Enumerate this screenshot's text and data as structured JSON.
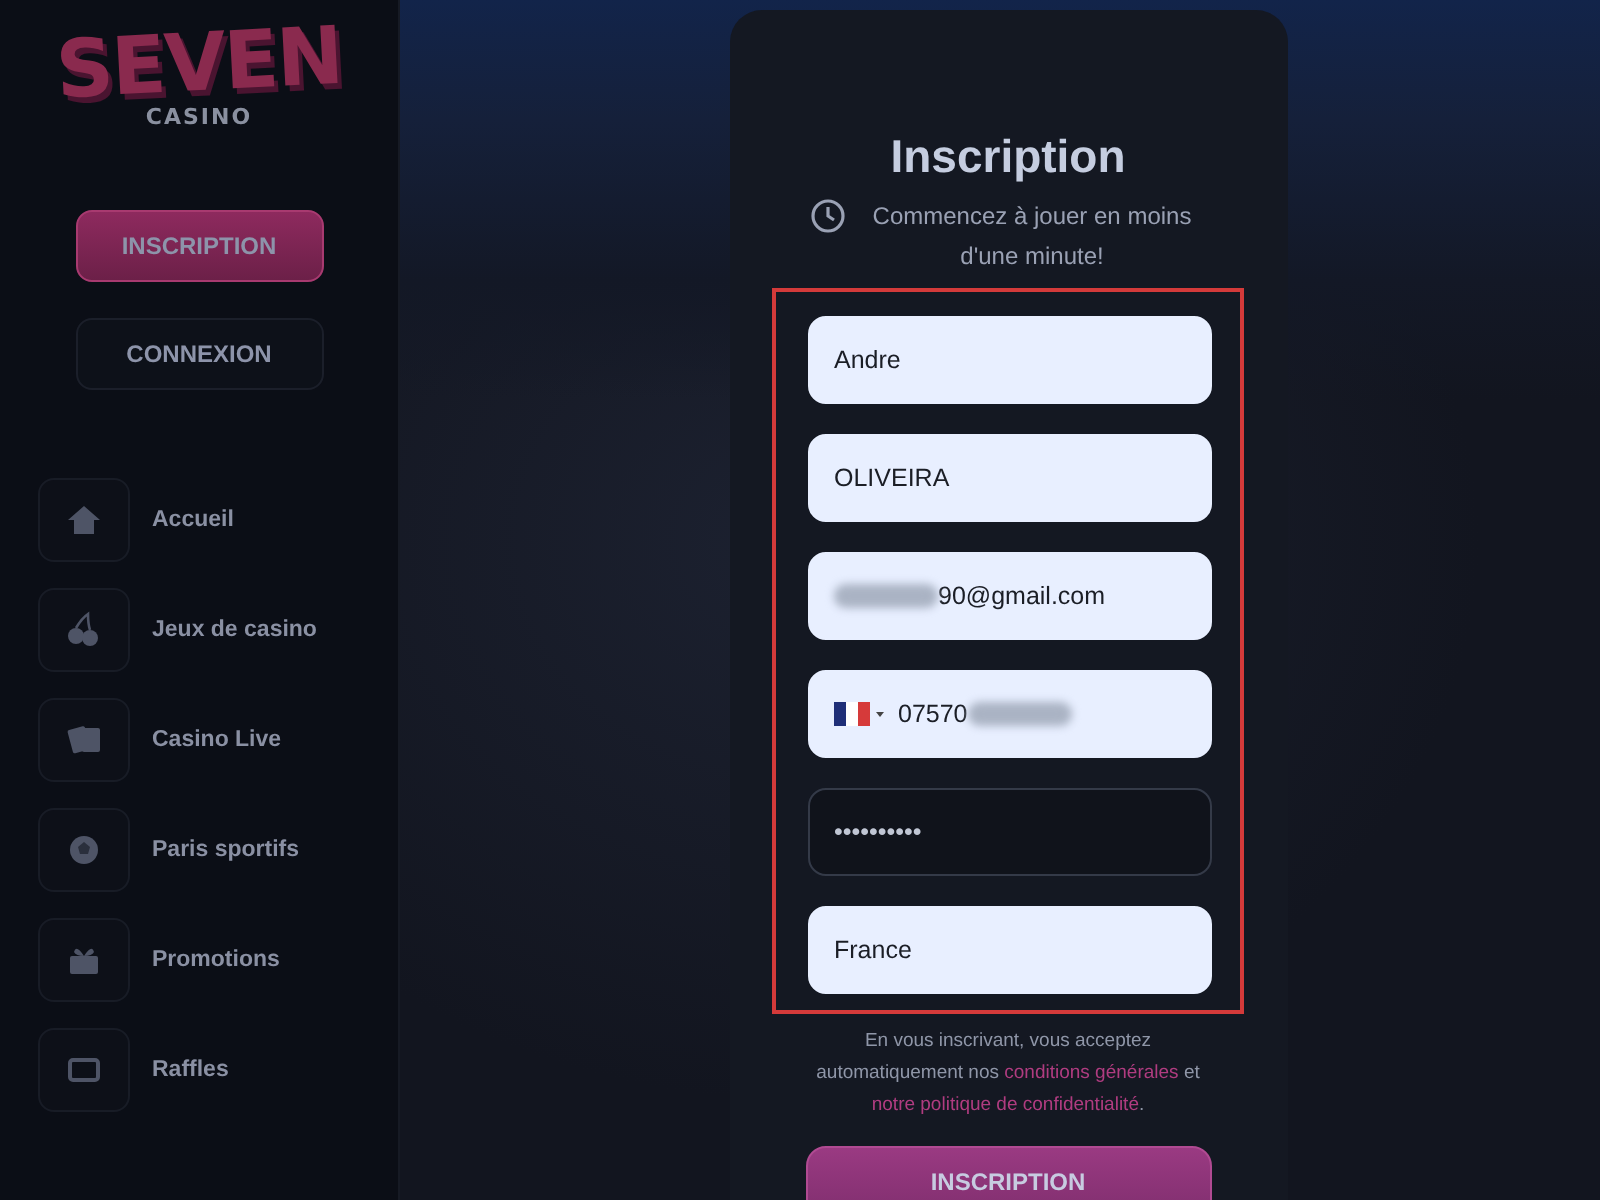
{
  "sidebar": {
    "logo": {
      "title": "SEVEN",
      "subtitle": "CASINO"
    },
    "buttons": [
      {
        "label": "INSCRIPTION",
        "kind": "primary"
      },
      {
        "label": "CONNEXION",
        "kind": "secondary"
      }
    ],
    "items": [
      {
        "label": "Accueil"
      },
      {
        "label": "Jeux de casino"
      },
      {
        "label": "Casino Live"
      },
      {
        "label": "Paris sportifs"
      },
      {
        "label": "Promotions"
      },
      {
        "label": "Raffles"
      }
    ]
  },
  "form": {
    "title": "Inscription",
    "subtitle": "Commencez à jouer en moins d'une minute!",
    "fields": [
      {
        "kind": "text",
        "value": "Andre"
      },
      {
        "kind": "text",
        "value": "OLIVEIRA"
      },
      {
        "kind": "redacted",
        "value": "90@gmail.com"
      },
      {
        "kind": "phone",
        "value": "07570"
      },
      {
        "kind": "password",
        "value": "••••••••••"
      },
      {
        "kind": "text",
        "value": "France"
      }
    ],
    "legal": {
      "before": "En vous inscrivant, vous acceptez automatiquement nos",
      "link1": "conditions générales",
      "middle": "et",
      "link2": "notre politique de confidentialité",
      "after": "."
    },
    "submit": "INSCRIPTION"
  }
}
